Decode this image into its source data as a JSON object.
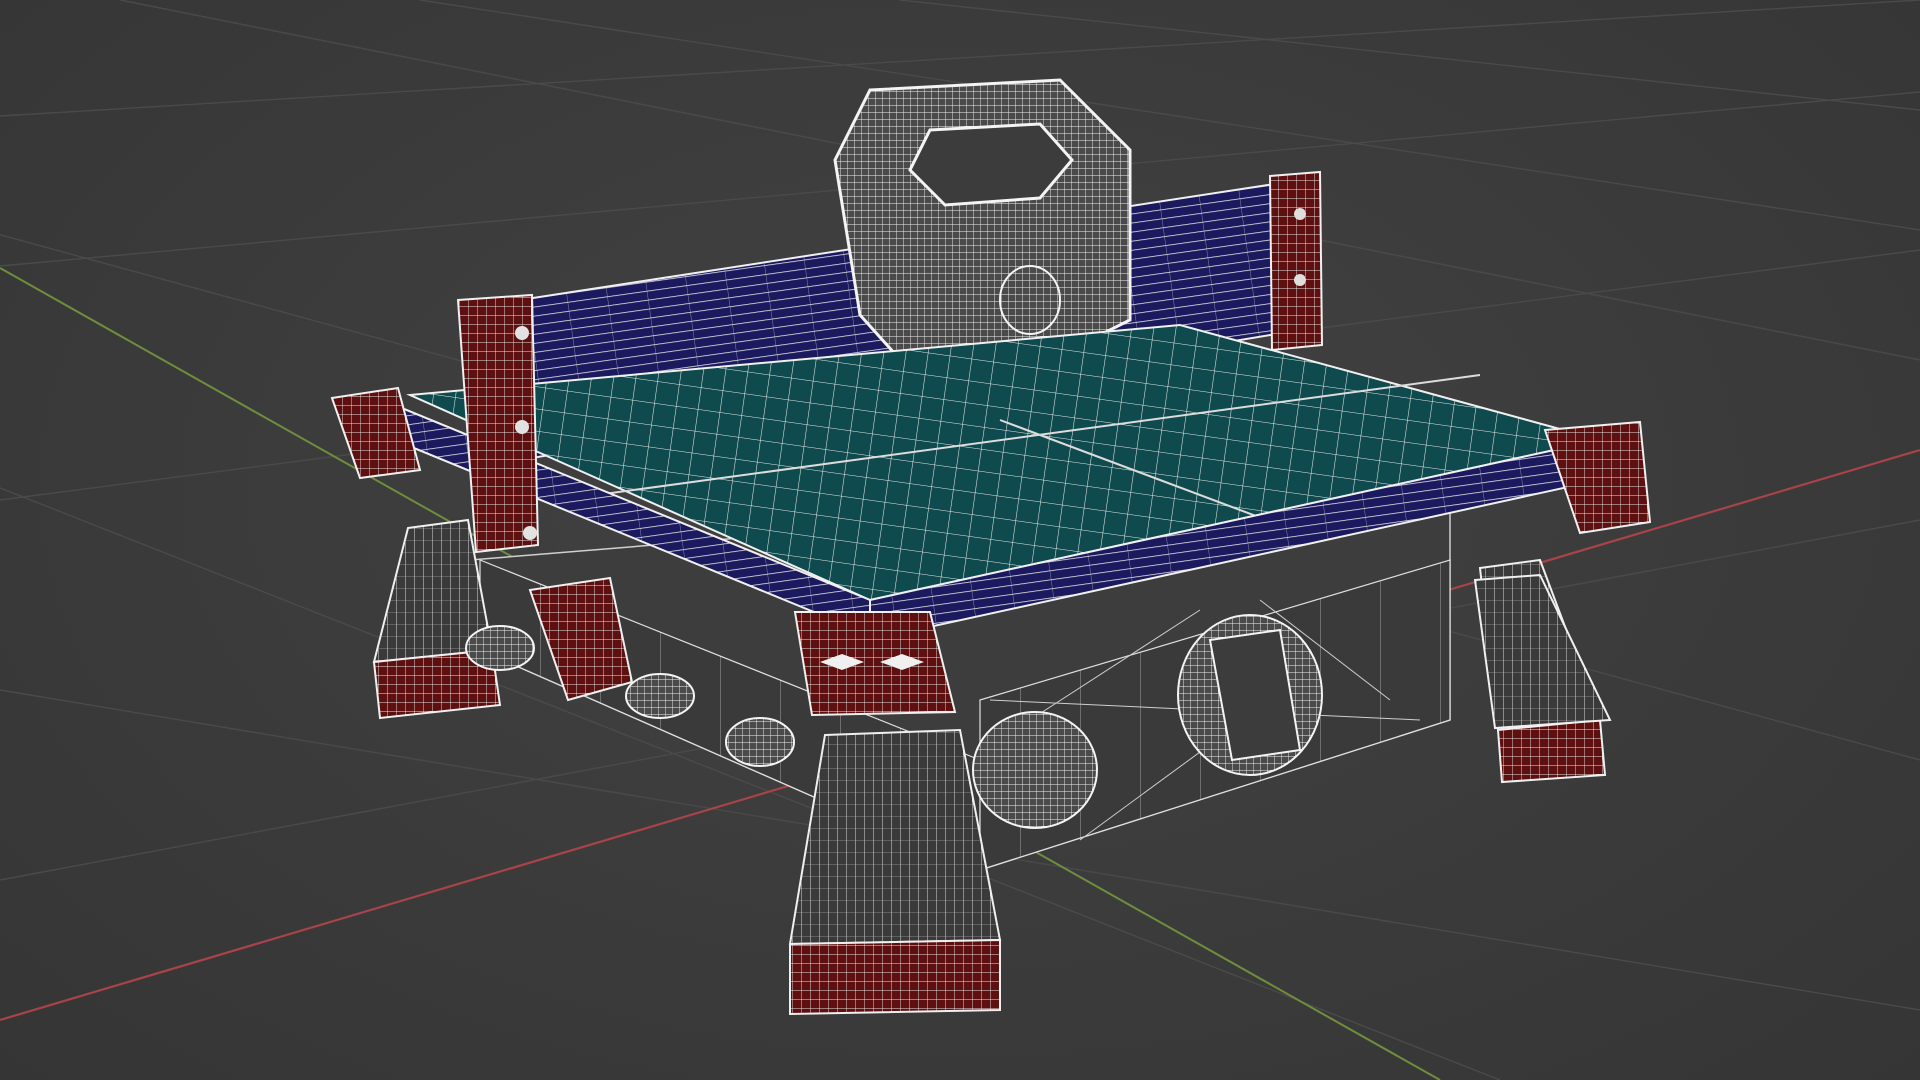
{
  "viewport": {
    "background": "#3c3c3c",
    "grid_line_color": "#4a4a4a",
    "x_axis_color": "#a8434a",
    "y_axis_color": "#6f8e3d"
  },
  "model": {
    "shading": "wireframe",
    "wire_color": "#ffffff",
    "materials": {
      "table_top": "#0f4a4e",
      "rails": "#1c1a5e",
      "accents": "#5e0f0f",
      "base": "#383838"
    },
    "parts": [
      "handle",
      "spindle-knob",
      "back-rail",
      "left-post",
      "right-post",
      "table-top",
      "corner-caps",
      "front-left-leg",
      "front-right-leg",
      "back-left-leg",
      "back-right-leg",
      "base-box",
      "front-knob",
      "side-dial",
      "side-screws"
    ]
  }
}
